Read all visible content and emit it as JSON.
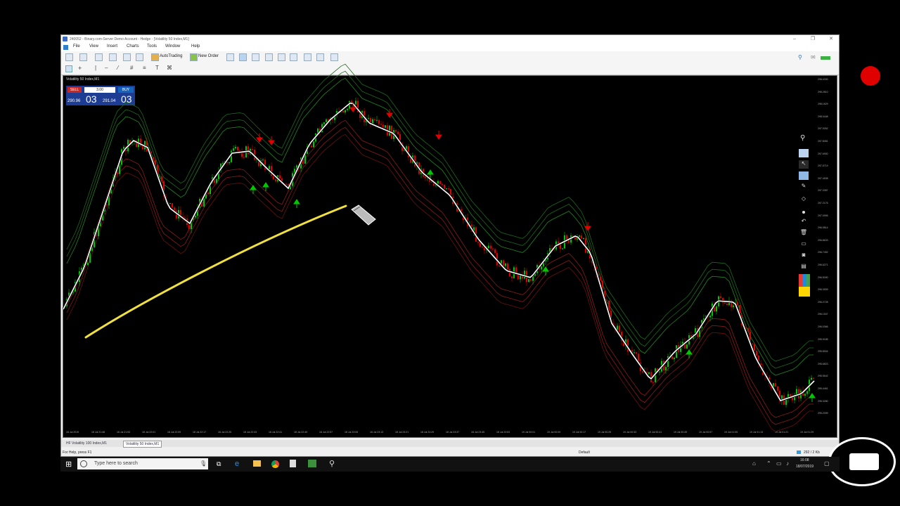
{
  "window": {
    "title": "240052 - Binary.com-Server Demo Account - Hedge - [Volatility 50 Index,M1]",
    "controls": [
      "–",
      "❐",
      "✕"
    ]
  },
  "menu": [
    "File",
    "View",
    "Insert",
    "Charts",
    "Tools",
    "Window",
    "Help"
  ],
  "toolbar": {
    "autotrading": "AutoTrading",
    "new_order": "New Order"
  },
  "trade_panel": {
    "title": "Volatility 50 Index,M1",
    "sell": "SELL",
    "buy": "BUY",
    "lot": "3.00",
    "sell_small": "290.96",
    "sell_big": "03",
    "buy_small": "291.04",
    "buy_big": "03"
  },
  "y_axis": [
    "298.4330",
    "298.2810",
    "298.1629",
    "298.0448",
    "297.9262",
    "297.8081",
    "297.6900",
    "297.5719",
    "297.4538",
    "297.3357",
    "297.2176",
    "297.0995",
    "296.9814",
    "296.8633",
    "296.7452",
    "296.6271",
    "296.5090",
    "296.3909",
    "296.2728",
    "296.1547",
    "296.0366",
    "295.9185",
    "295.8004",
    "295.6823",
    "295.5642",
    "295.4461",
    "295.3280",
    "295.2099"
  ],
  "x_axis": [
    "18 Jul 2019",
    "18 Jul 21:48",
    "18 Jul 21:53",
    "18 Jul 22:01",
    "18 Jul 22:09",
    "18 Jul 22:17",
    "18 Jul 22:25",
    "18 Jul 22:33",
    "18 Jul 22:41",
    "18 Jul 22:49",
    "18 Jul 22:57",
    "18 Jul 23:05",
    "18 Jul 23:13",
    "18 Jul 23:21",
    "18 Jul 23:29",
    "18 Jul 23:37",
    "18 Jul 23:45",
    "18 Jul 23:53",
    "19 Jul 00:01",
    "19 Jul 00:09",
    "19 Jul 00:17",
    "19 Jul 00:25",
    "19 Jul 00:33",
    "19 Jul 00:41",
    "19 Jul 00:49",
    "19 Jul 00:57",
    "19 Jul 01:05",
    "19 Jul 01:13",
    "19 Jul 01:21",
    "19 Jul 01:29"
  ],
  "tabs": [
    "HF Volatility 100 Index,M1",
    "Volatility 50 Index,M1"
  ],
  "status": {
    "help": "For Help, press F1",
    "profile": "Default",
    "traffic": "292 / 2 Kb"
  },
  "taskbar": {
    "search_placeholder": "Type here to search",
    "time": "16:08",
    "date": "18/07/2019"
  },
  "colors": {
    "bull": "#00c800",
    "bear": "#e00000",
    "wave": "#ffffff",
    "trendline": "#f0e040",
    "panel": "#1d3d94",
    "record": "#e00000"
  }
}
